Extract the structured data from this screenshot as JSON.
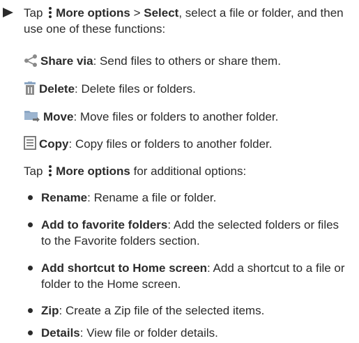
{
  "step": {
    "lead": "Tap",
    "more_options": "More options",
    "sep": " > ",
    "select": "Select",
    "rest": ", select a file or folder, and then use one of these functions:"
  },
  "functions": [
    {
      "icon": "share-icon",
      "name": "Share via",
      "desc": ": Send files to others or share them."
    },
    {
      "icon": "trash-icon",
      "name": "Delete",
      "desc": ": Delete files or folders."
    },
    {
      "icon": "move-folder-icon",
      "name": "Move",
      "desc": ": Move files or folders to another folder."
    },
    {
      "icon": "copy-icon",
      "name": "Copy",
      "desc": ": Copy files or folders to another folder."
    }
  ],
  "more": {
    "lead": "Tap",
    "more_options": "More options",
    "rest": " for additional options:"
  },
  "options": [
    {
      "name": "Rename",
      "desc": ": Rename a file or folder."
    },
    {
      "name": "Add to favorite folders",
      "desc": ": Add the selected folders or files to the Favorite folders section."
    },
    {
      "name": "Add shortcut to Home screen",
      "desc": ": Add a shortcut to a file or folder to the Home screen."
    },
    {
      "name": "Zip",
      "desc": ": Create a Zip file of the selected items."
    },
    {
      "name": "Details",
      "desc": ": View file or folder details."
    }
  ],
  "colors": {
    "text": "#2b2b2b",
    "icon_blue": "#8ba6c4",
    "icon_gray": "#6f6f6f"
  }
}
